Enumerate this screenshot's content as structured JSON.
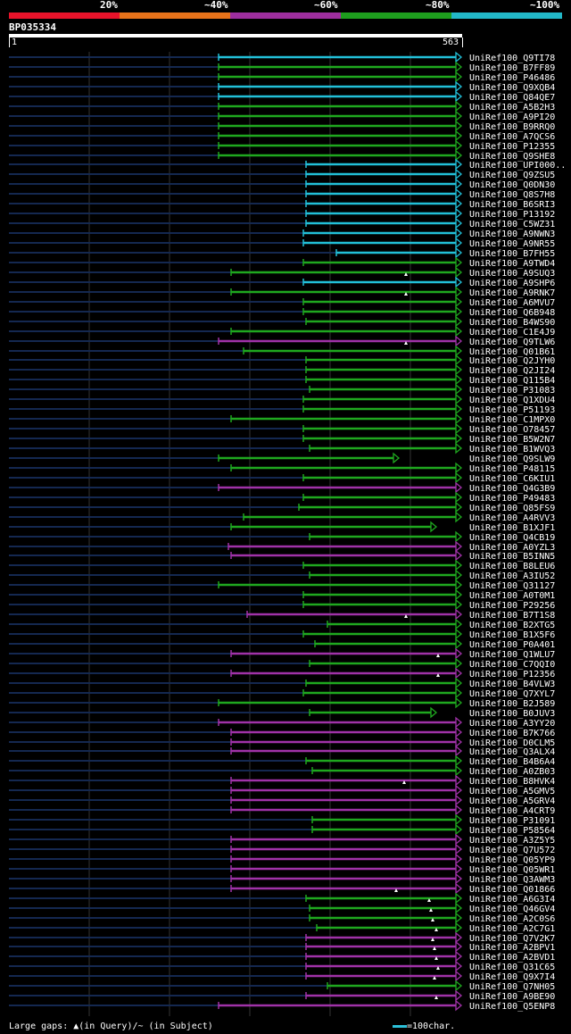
{
  "legend": {
    "labels": [
      "20%",
      "~40%",
      "~60%",
      "~80%",
      "~100%"
    ],
    "colors": [
      "#e8132a",
      "#e8731a",
      "#9e2e9e",
      "#1e9e1e",
      "#22b8c8"
    ]
  },
  "query": {
    "id": "BP035334",
    "start": "1",
    "end": "563"
  },
  "footer": {
    "gaps": "Large gaps: ▲(in Query)/~ (in Subject)",
    "scale": "=100char."
  },
  "colors": {
    "cyan": "#22c0d8",
    "green": "#1fa81f",
    "purple": "#a032a8",
    "dark": "#142850",
    "grid": "#333"
  },
  "hits": [
    {
      "n": "UniRef100_Q9TI78",
      "s": 245,
      "c": "cyan"
    },
    {
      "n": "UniRef100_B7FF89",
      "s": 245,
      "c": "green"
    },
    {
      "n": "UniRef100_P46486",
      "s": 245,
      "c": "green"
    },
    {
      "n": "UniRef100_Q9XQB4",
      "s": 245,
      "c": "cyan"
    },
    {
      "n": "UniRef100_Q84QE7",
      "s": 245,
      "c": "cyan"
    },
    {
      "n": "UniRef100_A5B2H3",
      "s": 245,
      "c": "green"
    },
    {
      "n": "UniRef100_A9PI20",
      "s": 245,
      "c": "green"
    },
    {
      "n": "UniRef100_B9RRQ0",
      "s": 245,
      "c": "green"
    },
    {
      "n": "UniRef100_A7QCS6",
      "s": 245,
      "c": "green"
    },
    {
      "n": "UniRef100_P12355",
      "s": 245,
      "c": "green"
    },
    {
      "n": "UniRef100_Q9SHE8",
      "s": 245,
      "c": "green"
    },
    {
      "n": "UniRef100_UPI000..",
      "s": 343,
      "c": "cyan"
    },
    {
      "n": "UniRef100_Q9ZSU5",
      "s": 343,
      "c": "cyan"
    },
    {
      "n": "UniRef100_Q0DN30",
      "s": 343,
      "c": "cyan"
    },
    {
      "n": "UniRef100_Q8S7H8",
      "s": 343,
      "c": "cyan"
    },
    {
      "n": "UniRef100_B6SRI3",
      "s": 343,
      "c": "cyan"
    },
    {
      "n": "UniRef100_P13192",
      "s": 343,
      "c": "cyan"
    },
    {
      "n": "UniRef100_C5WZ31",
      "s": 343,
      "c": "cyan"
    },
    {
      "n": "UniRef100_A9NWN3",
      "s": 340,
      "c": "cyan"
    },
    {
      "n": "UniRef100_A9NR55",
      "s": 340,
      "c": "cyan"
    },
    {
      "n": "UniRef100_B7FH55",
      "s": 377,
      "c": "cyan"
    },
    {
      "n": "UniRef100_A9TWD4",
      "s": 340,
      "c": "green"
    },
    {
      "n": "UniRef100_A9SUQ3",
      "s": 259,
      "c": "green",
      "t": 455
    },
    {
      "n": "UniRef100_A9SHP6",
      "s": 340,
      "c": "cyan"
    },
    {
      "n": "UniRef100_A9RNK7",
      "s": 259,
      "c": "green",
      "t": 455
    },
    {
      "n": "UniRef100_A6MVU7",
      "s": 340,
      "c": "green"
    },
    {
      "n": "UniRef100_Q6B948",
      "s": 340,
      "c": "green"
    },
    {
      "n": "UniRef100_B4WS90",
      "s": 343,
      "c": "green"
    },
    {
      "n": "UniRef100_C1E4J9",
      "s": 259,
      "c": "green"
    },
    {
      "n": "UniRef100_Q9TLW6",
      "s": 245,
      "c": "purple",
      "t": 455
    },
    {
      "n": "UniRef100_Q01B61",
      "s": 273,
      "c": "green"
    },
    {
      "n": "UniRef100_Q2JYH0",
      "s": 343,
      "c": "green"
    },
    {
      "n": "UniRef100_Q2JI24",
      "s": 343,
      "c": "green"
    },
    {
      "n": "UniRef100_Q115B4",
      "s": 343,
      "c": "green"
    },
    {
      "n": "UniRef100_P31083",
      "s": 347,
      "c": "green"
    },
    {
      "n": "UniRef100_Q1XDU4",
      "s": 340,
      "c": "green"
    },
    {
      "n": "UniRef100_P51193",
      "s": 340,
      "c": "green"
    },
    {
      "n": "UniRef100_C1MPX0",
      "s": 259,
      "c": "green"
    },
    {
      "n": "UniRef100_O78457",
      "s": 340,
      "c": "green"
    },
    {
      "n": "UniRef100_B5W2N7",
      "s": 340,
      "c": "green"
    },
    {
      "n": "UniRef100_B1WVQ3",
      "s": 347,
      "c": "green"
    },
    {
      "n": "UniRef100_Q9SLW9",
      "s": 245,
      "c": "green",
      "e": 441
    },
    {
      "n": "UniRef100_P48115",
      "s": 259,
      "c": "green"
    },
    {
      "n": "UniRef100_C6KIU1",
      "s": 340,
      "c": "green"
    },
    {
      "n": "UniRef100_Q4G3B9",
      "s": 245,
      "c": "purple"
    },
    {
      "n": "UniRef100_P49483",
      "s": 340,
      "c": "green",
      "e": 511
    },
    {
      "n": "UniRef100_Q85FS9",
      "s": 335,
      "c": "green",
      "e": 511
    },
    {
      "n": "UniRef100_A4RVV3",
      "s": 273,
      "c": "green"
    },
    {
      "n": "UniRef100_B1XJF1",
      "s": 259,
      "c": "green",
      "e": 483
    },
    {
      "n": "UniRef100_Q4CB19",
      "s": 347,
      "c": "green"
    },
    {
      "n": "UniRef100_A0YZL3",
      "s": 256,
      "c": "purple"
    },
    {
      "n": "UniRef100_B5INN5",
      "s": 259,
      "c": "purple"
    },
    {
      "n": "UniRef100_B8LEU6",
      "s": 340,
      "c": "green",
      "e": 511
    },
    {
      "n": "UniRef100_A3IU52",
      "s": 347,
      "c": "green"
    },
    {
      "n": "UniRef100_Q31127",
      "s": 245,
      "c": "green"
    },
    {
      "n": "UniRef100_A0T0M1",
      "s": 340,
      "c": "green"
    },
    {
      "n": "UniRef100_P29256",
      "s": 340,
      "c": "green"
    },
    {
      "n": "UniRef100_B7T1S8",
      "s": 277,
      "c": "purple",
      "t": 455
    },
    {
      "n": "UniRef100_B2XTG5",
      "s": 367,
      "c": "green"
    },
    {
      "n": "UniRef100_B1X5F6",
      "s": 340,
      "c": "green"
    },
    {
      "n": "UniRef100_P0A401",
      "s": 353,
      "c": "green"
    },
    {
      "n": "UniRef100_Q1WLU7",
      "s": 259,
      "c": "purple",
      "t": 491
    },
    {
      "n": "UniRef100_C7QQI0",
      "s": 347,
      "c": "green"
    },
    {
      "n": "UniRef100_P12356",
      "s": 259,
      "c": "purple",
      "t": 491
    },
    {
      "n": "UniRef100_B4VLW3",
      "s": 343,
      "c": "green"
    },
    {
      "n": "UniRef100_Q7XYL7",
      "s": 340,
      "c": "green"
    },
    {
      "n": "UniRef100_B2J589",
      "s": 245,
      "c": "green"
    },
    {
      "n": "UniRef100_B0JUV3",
      "s": 347,
      "c": "green",
      "e": 483
    },
    {
      "n": "UniRef100_A3YY20",
      "s": 245,
      "c": "purple",
      "e": 511
    },
    {
      "n": "UniRef100_B7K766",
      "s": 259,
      "c": "purple"
    },
    {
      "n": "UniRef100_D0CLM5",
      "s": 259,
      "c": "purple"
    },
    {
      "n": "UniRef100_Q3ALX4",
      "s": 259,
      "c": "purple"
    },
    {
      "n": "UniRef100_B4B6A4",
      "s": 343,
      "c": "green"
    },
    {
      "n": "UniRef100_A0ZB03",
      "s": 350,
      "c": "green"
    },
    {
      "n": "UniRef100_B8HVK4",
      "s": 259,
      "c": "purple",
      "t": 453
    },
    {
      "n": "UniRef100_A5GMV5",
      "s": 259,
      "c": "purple"
    },
    {
      "n": "UniRef100_A5GRV4",
      "s": 259,
      "c": "purple",
      "e": 511
    },
    {
      "n": "UniRef100_A4CRT9",
      "s": 259,
      "c": "purple"
    },
    {
      "n": "UniRef100_P31091",
      "s": 350,
      "c": "green"
    },
    {
      "n": "UniRef100_P58564",
      "s": 350,
      "c": "green"
    },
    {
      "n": "UniRef100_A3Z5Y5",
      "s": 259,
      "c": "purple"
    },
    {
      "n": "UniRef100_Q7U572",
      "s": 259,
      "c": "purple"
    },
    {
      "n": "UniRef100_Q05YP9",
      "s": 259,
      "c": "purple"
    },
    {
      "n": "UniRef100_Q05WR1",
      "s": 259,
      "c": "purple"
    },
    {
      "n": "UniRef100_Q3AWM3",
      "s": 259,
      "c": "purple",
      "e": 511
    },
    {
      "n": "UniRef100_Q01866",
      "s": 259,
      "c": "purple",
      "t": 444
    },
    {
      "n": "UniRef100_A6G3I4",
      "s": 343,
      "c": "green",
      "t": 481
    },
    {
      "n": "UniRef100_Q46GV4",
      "s": 347,
      "c": "green",
      "t": 483
    },
    {
      "n": "UniRef100_A2C0S6",
      "s": 347,
      "c": "green",
      "t": 485
    },
    {
      "n": "UniRef100_A2C7G1",
      "s": 355,
      "c": "green",
      "t": 489
    },
    {
      "n": "UniRef100_Q7V2K7",
      "s": 343,
      "c": "purple",
      "t": 485
    },
    {
      "n": "UniRef100_A2BPV1",
      "s": 343,
      "c": "purple",
      "t": 487
    },
    {
      "n": "UniRef100_A2BVD1",
      "s": 343,
      "c": "purple",
      "t": 489
    },
    {
      "n": "UniRef100_Q31C65",
      "s": 343,
      "c": "purple",
      "t": 491
    },
    {
      "n": "UniRef100_Q9X7I4",
      "s": 343,
      "c": "purple",
      "t": 487
    },
    {
      "n": "UniRef100_Q7NH05",
      "s": 367,
      "c": "green"
    },
    {
      "n": "UniRef100_A9BE90",
      "s": 343,
      "c": "purple",
      "t": 489
    },
    {
      "n": "UniRef100_Q5ENP8",
      "s": 245,
      "c": "purple"
    }
  ]
}
